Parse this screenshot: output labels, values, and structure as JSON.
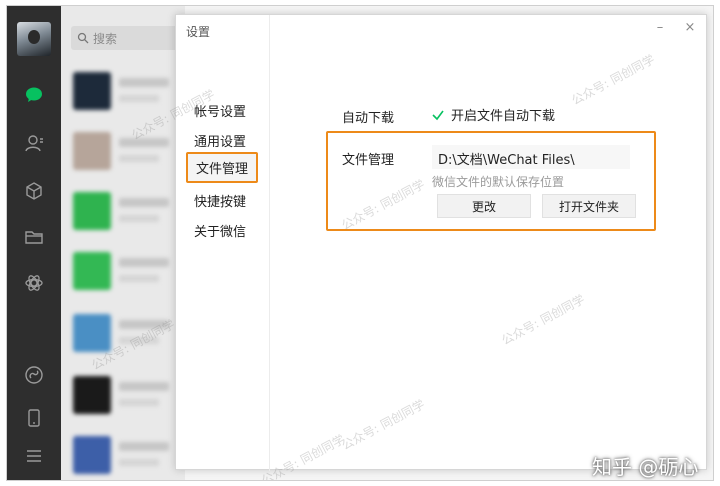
{
  "search": {
    "placeholder": "搜索",
    "icon": "search-icon"
  },
  "rail": {
    "icons": [
      "chat-icon",
      "contacts-icon",
      "favorites-icon",
      "folder-icon",
      "moments-icon",
      "miniprogram-icon",
      "phone-icon",
      "menu-icon"
    ],
    "active_color": "#07c160"
  },
  "dialog": {
    "title": "设置",
    "minimize": "–",
    "close": "×",
    "nav": [
      {
        "label": "帐号设置"
      },
      {
        "label": "通用设置"
      },
      {
        "label": "文件管理"
      },
      {
        "label": "快捷按键"
      },
      {
        "label": "关于微信"
      }
    ],
    "active_nav": "文件管理",
    "accent_color": "#ed8a19",
    "auto_download": {
      "label": "自动下载",
      "checkbox_label": "开启文件自动下载",
      "checked": true
    },
    "file_management": {
      "label": "文件管理",
      "path": "D:\\文档\\WeChat Files\\",
      "hint": "微信文件的默认保存位置",
      "change_button": "更改",
      "open_folder_button": "打开文件夹"
    }
  },
  "watermark": "公众号: 同创同学",
  "brand": "知乎 @砺心"
}
